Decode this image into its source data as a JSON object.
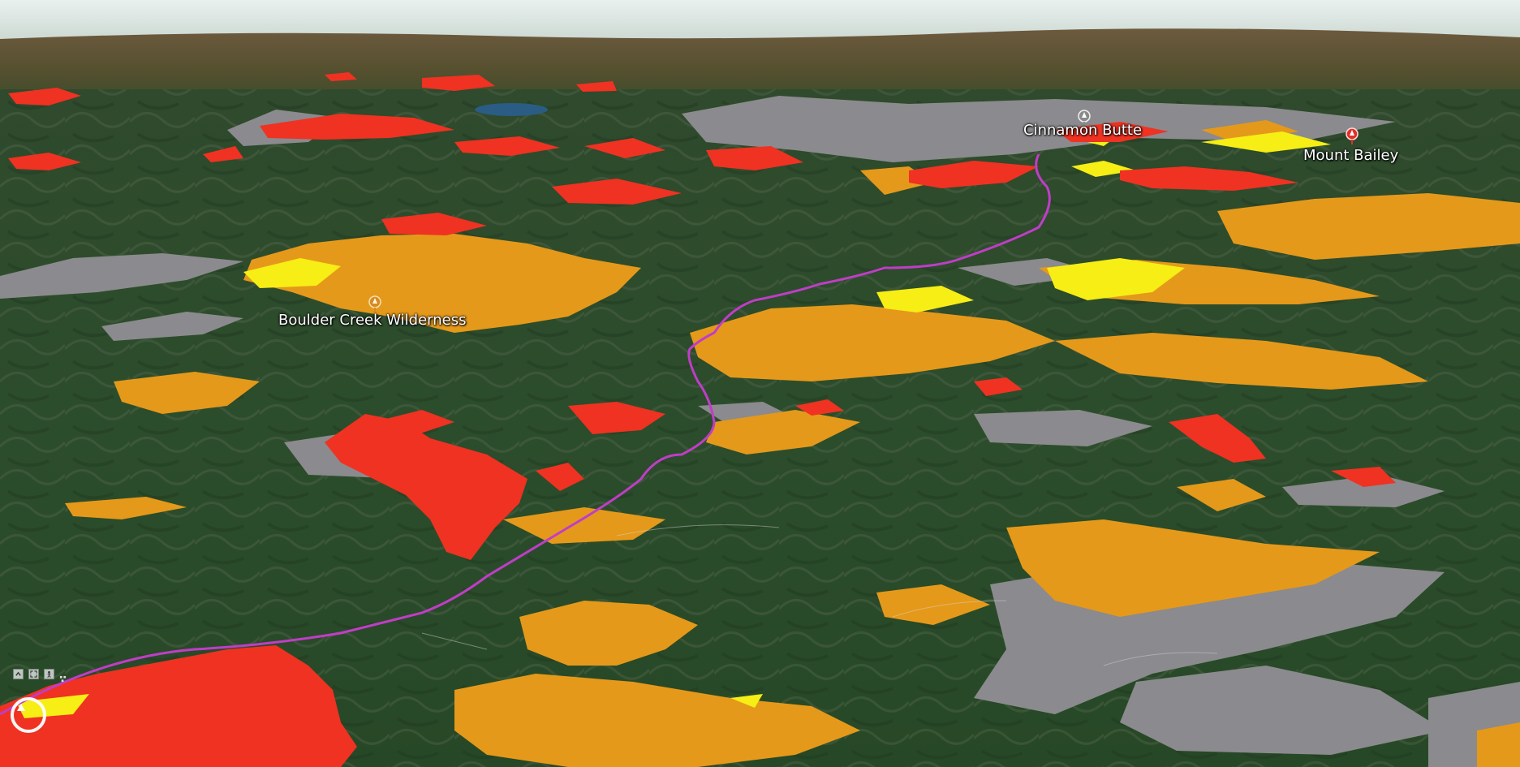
{
  "map": {
    "view": "3D terrain perspective, satellite imagery with colored overlay polygons",
    "overlay_colors": {
      "red": "#ef3222",
      "orange": "#e5991a",
      "yellow": "#f6ee15",
      "gray": "#8b8a8e",
      "route": "#c03dc8"
    },
    "places": [
      {
        "id": "boulder",
        "label": "Boulder Creek Wilderness",
        "icon": "wilderness-marker-icon"
      },
      {
        "id": "cinnamon",
        "label": "Cinnamon Butte",
        "icon": "summit-marker-icon"
      },
      {
        "id": "bailey",
        "label": "Mount Bailey",
        "icon": "summit-marker-icon-red"
      }
    ]
  },
  "controls": {
    "nav_icons": [
      "pan-up-icon",
      "zoom-extent-icon",
      "person-view-icon",
      "tilt-icon"
    ],
    "compass_icon": "compass-reset-icon"
  }
}
